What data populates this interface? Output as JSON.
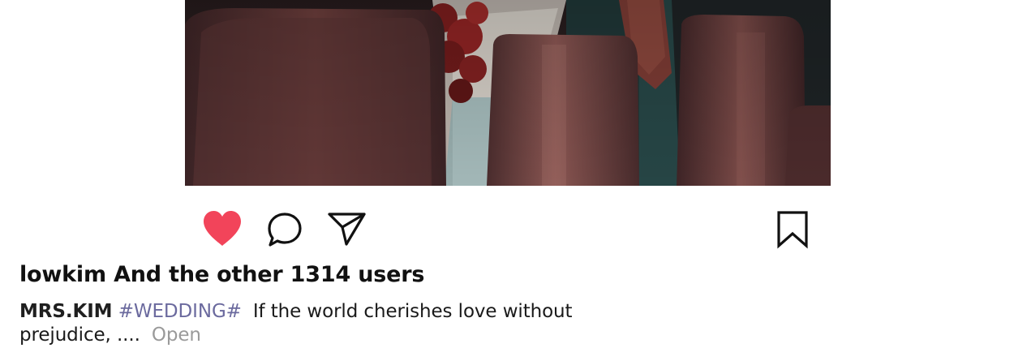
{
  "post": {
    "likes_text": "lowkim And the other 1314 users",
    "caption": {
      "username": "MRS.KIM",
      "hashtag": "#WEDDING#",
      "text": "If the world cherishes love without prejudice, ....",
      "more_label": "Open"
    }
  },
  "icons": {
    "like": "heart-icon",
    "comment": "speech-bubble-icon",
    "share": "paper-plane-icon",
    "save": "bookmark-icon"
  },
  "colors": {
    "like_active": "#f2445a",
    "hashtag": "#6b6a9e",
    "more_link": "#9a9a9a"
  }
}
